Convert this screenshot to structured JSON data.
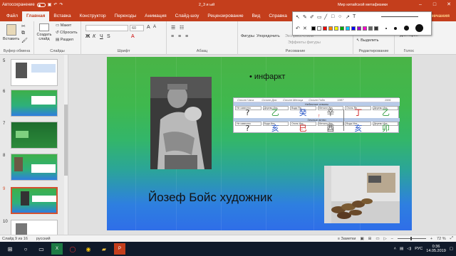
{
  "titlebar": {
    "autosave_label": "Автосохранение",
    "autosave_state": "Откл.",
    "doc_title": "2_3 и ый",
    "app_title": "Мир китайской метафизики",
    "user": "Ч"
  },
  "tabs": [
    "Файл",
    "Главная",
    "Вставка",
    "Конструктор",
    "Переходы",
    "Анимация",
    "Слайд-шоу",
    "Рецензирование",
    "Вид",
    "Справка"
  ],
  "share_label": "Примечания",
  "ribbon": {
    "paste": "Вставить",
    "clipboard": "Буфер обмена",
    "new_slide": "Создать слайд",
    "layout": "Макет",
    "reset": "Сбросить",
    "section": "Раздел",
    "slides": "Слайды",
    "font_size": "60",
    "font": "Шрифт",
    "paragraph": "Абзац",
    "shapes": "Фигуры",
    "arrange": "Упорядочить",
    "quick_styles": "Экспресс-стили",
    "shape_effects": "Эффекты фигуры",
    "drawing": "Рисование",
    "select": "Выделить",
    "editing": "Редактирование",
    "dictate": "Диктофон",
    "voice": "Голос"
  },
  "thumbnails": [
    {
      "num": "5"
    },
    {
      "num": "6"
    },
    {
      "num": "7"
    },
    {
      "num": "8"
    },
    {
      "num": "9",
      "selected": true
    },
    {
      "num": "10"
    }
  ],
  "slide": {
    "bullet": "• инфаркт",
    "title": "Йозеф Бойс художник",
    "table": {
      "headers": [
        "Столп Часа",
        "Столп Дня",
        "Столп Месяца",
        "Столп Года",
        "1987",
        "",
        "1991"
      ],
      "band1": "Небесные стволы",
      "band2": "Земные ветви",
      "row1_boxes": [
        "Не известно",
        "Дерево Инь",
        "Вода Ян",
        "Металл Инь",
        "Огонь Ян",
        "Дерево Инь"
      ],
      "row1_glyphs": [
        "?",
        "乙",
        "癸",
        "辛",
        "丁",
        "乙"
      ],
      "row1_sub": [
        "",
        "Времена",
        "Косые копья",
        "7-6 Мейбы",
        "Для дополнения",
        "Времена"
      ],
      "row2_boxes": [
        "Не известно",
        "Вода Инь",
        "Огонь Инь",
        "Металл Инь",
        "Вода Инь",
        "Дерево Инь"
      ],
      "row2_glyphs": [
        "?",
        "亥",
        "巳",
        "酉",
        "亥",
        "卯"
      ],
      "row2_sub": [
        "",
        "Свинья",
        "Змея",
        "Петух",
        "Свинья",
        "Кролик"
      ]
    }
  },
  "status": {
    "slide": "Слайд 9 из 16",
    "lang": "русский",
    "notes": "Заметки",
    "zoom": "72 %"
  },
  "taskbar": {
    "lang": "РУС",
    "time": "0:36",
    "date": "14.05.2019"
  },
  "colors": {
    "accent": "#c43e1c",
    "selected_border": "#d35230"
  }
}
